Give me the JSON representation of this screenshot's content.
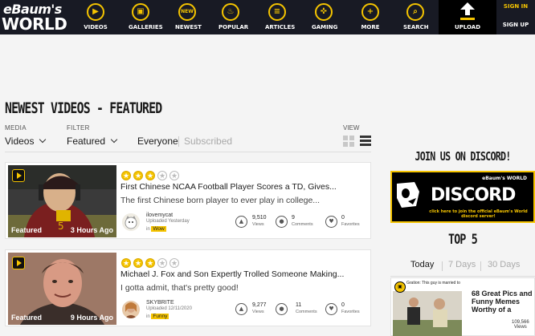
{
  "nav": {
    "logo_line1": "eBaum's",
    "logo_line2": "WORLD",
    "items": [
      {
        "label": "VIDEOS",
        "glyph": "▶",
        "icon": "play-icon"
      },
      {
        "label": "GALLERIES",
        "glyph": "▣",
        "icon": "gallery-icon"
      },
      {
        "label": "NEWEST",
        "glyph": "NEW",
        "icon": "new-icon"
      },
      {
        "label": "POPULAR",
        "glyph": "♨",
        "icon": "flame-icon"
      },
      {
        "label": "ARTICLES",
        "glyph": "≡",
        "icon": "article-icon"
      },
      {
        "label": "GAMING",
        "glyph": "✜",
        "icon": "gamepad-icon"
      },
      {
        "label": "MORE",
        "glyph": "+",
        "icon": "plus-icon"
      },
      {
        "label": "SEARCH",
        "glyph": "⌕",
        "icon": "search-icon"
      }
    ],
    "upload": "UPLOAD",
    "sign_in": "SIGN IN",
    "sign_up": "SIGN UP"
  },
  "page": {
    "title": "NEWEST VIDEOS - FEATURED",
    "media_label": "MEDIA",
    "media_value": "Videos",
    "filter_label": "FILTER",
    "filter_value": "Featured",
    "everyone": "Everyone",
    "subscribed": "Subscribed",
    "view_label": "VIEW"
  },
  "videos": [
    {
      "title": "First Chinese NCAA Football Player Scores a TD, Gives...",
      "description": "The first Chinese born player to ever play in college...",
      "rating": 3,
      "badge": "Featured",
      "time": "3 Hours Ago",
      "user": "ilovemycat",
      "uploaded": "Uploaded Yesterday",
      "in": "in",
      "category": "Wow",
      "views": "9,510",
      "views_label": "Views",
      "comments": "9",
      "comments_label": "Comments",
      "favorites": "0",
      "favorites_label": "Favorites"
    },
    {
      "title": "Michael J. Fox and Son Expertly Trolled Someone Making...",
      "description": "I gotta admit, that's pretty good!",
      "rating": 3,
      "badge": "Featured",
      "time": "9 Hours Ago",
      "user": "SKYBRITE",
      "uploaded": "Uploaded 12/11/2020",
      "in": "in",
      "category": "Funny",
      "views": "9,277",
      "views_label": "Views",
      "comments": "11",
      "comments_label": "Comments",
      "favorites": "0",
      "favorites_label": "Favorites"
    }
  ],
  "sidebar": {
    "discord_heading": "JOIN US ON DISCORD!",
    "discord_banner_text": "DISCORD",
    "discord_banner_brand": "eBaum's WORLD",
    "discord_banner_cta": "click here to join the official eBaum's World discord server!",
    "top5_heading": "TOP 5",
    "tabs": [
      "Today",
      "7 Days",
      "30 Days"
    ],
    "top_item": {
      "title": "68 Great Pics and Funny Memes Worthy of a",
      "views": "109,566",
      "views_label": "Views",
      "thumb_caption": "Gration: This guy is married to"
    }
  },
  "colors": {
    "accent": "#f5c400",
    "nav_bg": "#181a24",
    "page_bg": "#f4f4f4"
  }
}
